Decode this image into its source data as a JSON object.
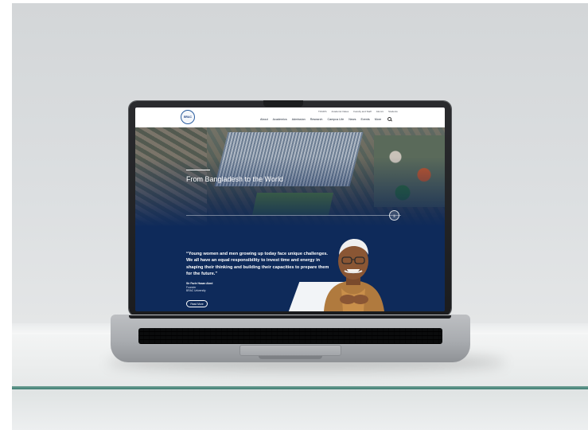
{
  "website": {
    "logo_text": "BRAC",
    "top_nav": [
      "TOURS",
      "Academic Dates",
      "Faculty and Staff",
      "Alumni",
      "Students"
    ],
    "main_nav": [
      "About",
      "Academics",
      "Admission",
      "Research",
      "Campus Life",
      "News",
      "Events",
      "More"
    ],
    "hero": {
      "title": "From Bangladesh to the World",
      "button_symbol": "||"
    },
    "quote": {
      "text": "“Young women and men growing up today face unique challenges. We all have an equal responsibility to invest time and energy in shaping their thinking and building their capacities to prepare them for the future.”",
      "author_name": "Sir Fazle Hasan Abed",
      "author_role": "Founder",
      "author_org": "BRAC University",
      "read_more": "Read More"
    }
  },
  "colors": {
    "site_navy": "#0e2a5a",
    "shelf_edge": "#3f7f73"
  }
}
